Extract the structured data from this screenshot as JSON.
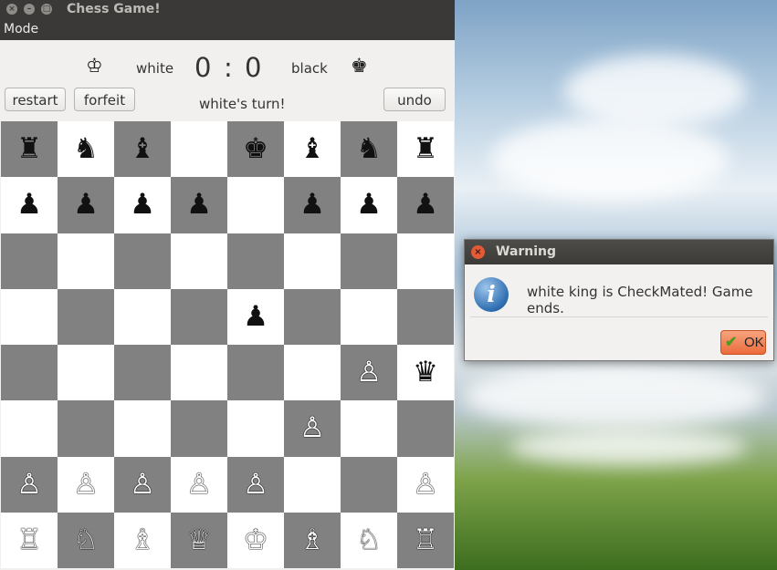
{
  "window": {
    "title": "Chess Game!",
    "menu": [
      "Mode"
    ]
  },
  "score": {
    "white_label": "white",
    "black_label": "black",
    "white_score": "0",
    "separator": ":",
    "black_score": "0",
    "white_king_glyph": "♔",
    "black_king_glyph": "♚"
  },
  "controls": {
    "restart_label": "restart",
    "forfeit_label": "forfeit",
    "undo_label": "undo",
    "turn_status": "white's turn!"
  },
  "board": {
    "rows": [
      [
        "♜",
        "♞",
        "♝",
        "",
        "♚",
        "♝",
        "♞",
        "♜"
      ],
      [
        "♟",
        "♟",
        "♟",
        "♟",
        "",
        "♟",
        "♟",
        "♟"
      ],
      [
        "",
        "",
        "",
        "",
        "",
        "",
        "",
        ""
      ],
      [
        "",
        "",
        "",
        "",
        "♟",
        "",
        "",
        ""
      ],
      [
        "",
        "",
        "",
        "",
        "",
        "",
        "♙",
        "♛"
      ],
      [
        "",
        "",
        "",
        "",
        "",
        "♙",
        "",
        ""
      ],
      [
        "♙",
        "♙",
        "♙",
        "♙",
        "♙",
        "",
        "",
        "♙"
      ],
      [
        "♖",
        "♘",
        "♗",
        "♕",
        "♔",
        "♗",
        "♘",
        "♖"
      ]
    ],
    "colors": {
      "dark": "#818181",
      "light": "#ffffff"
    }
  },
  "dialog": {
    "title": "Warning",
    "icon": "info-icon",
    "message": "white king is CheckMated! Game ends.",
    "ok_label": "OK"
  }
}
